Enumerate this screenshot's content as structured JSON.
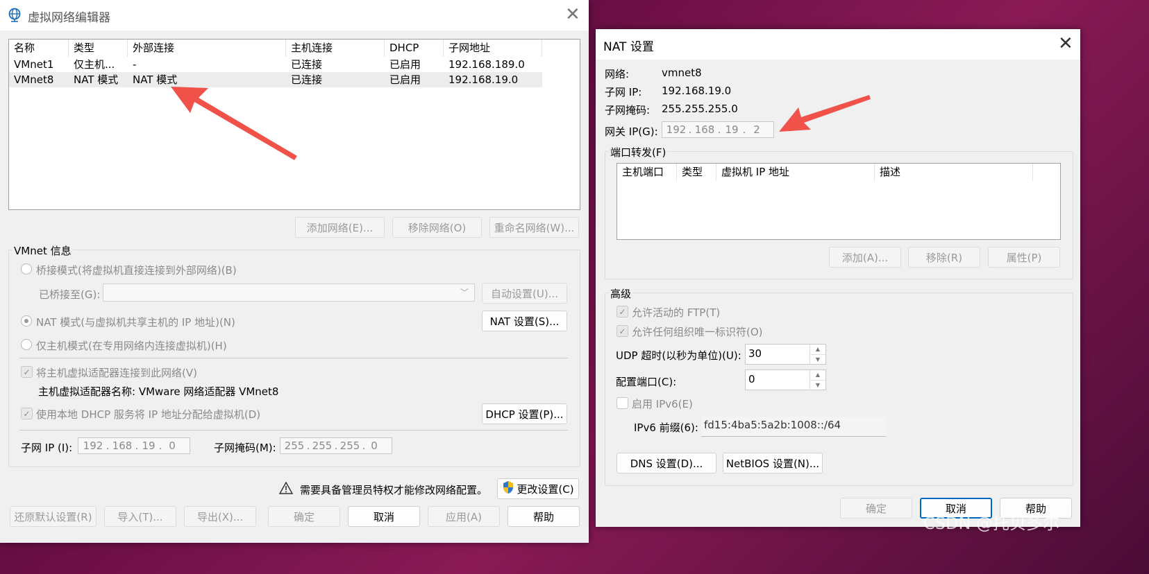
{
  "left_window": {
    "title": "虚拟网络编辑器",
    "columns": [
      "名称",
      "类型",
      "外部连接",
      "主机连接",
      "DHCP",
      "子网地址"
    ],
    "rows": [
      [
        "VMnet1",
        "仅主机...",
        "-",
        "已连接",
        "已启用",
        "192.168.189.0"
      ],
      [
        "VMnet8",
        "NAT 模式",
        "NAT 模式",
        "已连接",
        "已启用",
        "192.168.19.0"
      ]
    ],
    "add_network": "添加网络(E)...",
    "remove_network": "移除网络(O)",
    "rename_network": "重命名网络(W)...",
    "vmnet_info": "VMnet 信息",
    "bridge_mode": "桥接模式(将虚拟机直接连接到外部网络)(B)",
    "bridged_to": "已桥接至(G):",
    "auto_settings": "自动设置(U)...",
    "nat_mode": "NAT 模式(与虚拟机共享主机的 IP 地址)(N)",
    "nat_settings": "NAT 设置(S)...",
    "host_only": "仅主机模式(在专用网络内连接虚拟机)(H)",
    "connect_adapter": "将主机虚拟适配器连接到此网络(V)",
    "adapter_name": "主机虚拟适配器名称: VMware 网络适配器 VMnet8",
    "use_dhcp": "使用本地 DHCP 服务将 IP 地址分配给虚拟机(D)",
    "dhcp_settings": "DHCP 设置(P)...",
    "subnet_ip_label": "子网 IP (I):",
    "subnet_ip": [
      "192",
      "168",
      "19",
      "0"
    ],
    "subnet_mask_label": "子网掩码(M):",
    "subnet_mask": [
      "255",
      "255",
      "255",
      "0"
    ],
    "admin_notice": "需要具备管理员特权才能修改网络配置。",
    "change_settings": "更改设置(C)",
    "restore_defaults": "还原默认设置(R)",
    "import": "导入(T)...",
    "export": "导出(X)...",
    "ok": "确定",
    "cancel": "取消",
    "apply": "应用(A)",
    "help": "帮助"
  },
  "right_window": {
    "title": "NAT 设置",
    "network_label": "网络:",
    "network_value": "vmnet8",
    "subnet_ip_label": "子网 IP:",
    "subnet_ip_value": "192.168.19.0",
    "subnet_mask_label": "子网掩码:",
    "subnet_mask_value": "255.255.255.0",
    "gateway_label": "网关 IP(G):",
    "gateway_ip": [
      "192",
      "168",
      "19",
      "2"
    ],
    "port_forwarding": "端口转发(F)",
    "pf_columns": [
      "主机端口",
      "类型",
      "虚拟机 IP 地址",
      "描述"
    ],
    "add": "添加(A)...",
    "remove": "移除(R)",
    "properties": "属性(P)",
    "advanced": "高级",
    "allow_ftp": "允许活动的 FTP(T)",
    "allow_oui": "允许任何组织唯一标识符(O)",
    "udp_timeout_label": "UDP 超时(以秒为单位)(U):",
    "udp_timeout": "30",
    "config_port_label": "配置端口(C):",
    "config_port": "0",
    "enable_ipv6": "启用 IPv6(E)",
    "ipv6_prefix_label": "IPv6 前缀(6):",
    "ipv6_prefix": "fd15:4ba5:5a2b:1008::/64",
    "dns_settings": "DNS 设置(D)...",
    "netbios_settings": "NetBIOS 设置(N)...",
    "ok": "确定",
    "cancel": "取消",
    "help": "帮助"
  },
  "watermark": "CSDN @托贝多尔",
  "colors": {
    "arrow": "#f0524a",
    "accent": "#0067c0"
  }
}
